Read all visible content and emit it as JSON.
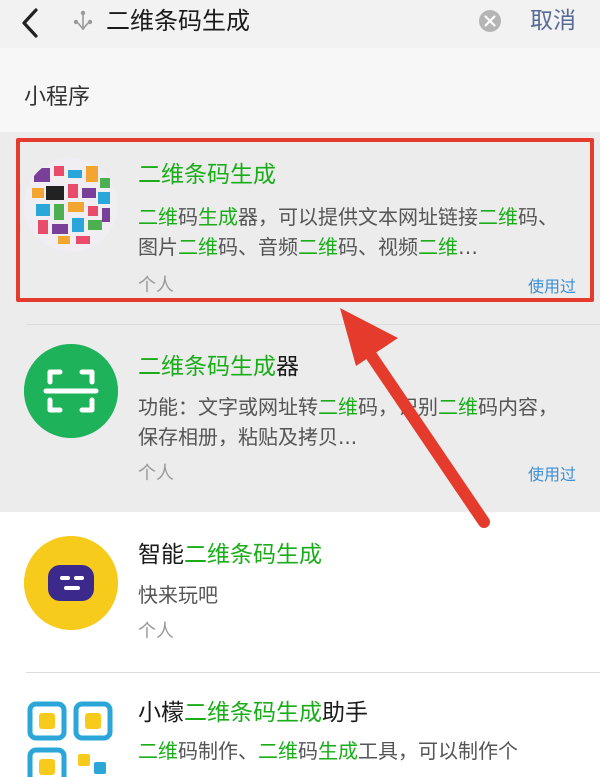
{
  "header": {
    "back_label": "<",
    "search_query": "二维条码生成",
    "cancel_label": "取消"
  },
  "section": {
    "label": "小程序"
  },
  "results": [
    {
      "title_parts": [
        {
          "text": "二维条码生成",
          "hl": true
        }
      ],
      "desc_parts": [
        {
          "text": "二维",
          "hl": true
        },
        {
          "text": "码",
          "hl": false
        },
        {
          "text": "生成",
          "hl": true
        },
        {
          "text": "器，可以提供文本网址链接",
          "hl": false
        },
        {
          "text": "二维",
          "hl": true
        },
        {
          "text": "码、图片",
          "hl": false
        },
        {
          "text": "二维",
          "hl": true
        },
        {
          "text": "码、音频",
          "hl": false
        },
        {
          "text": "二维",
          "hl": true
        },
        {
          "text": "码、视频",
          "hl": false
        },
        {
          "text": "二维",
          "hl": true
        },
        {
          "text": "…",
          "hl": false
        }
      ],
      "meta": "个人",
      "used_label": "使用过",
      "avatar_icon": "qr-collage-icon"
    },
    {
      "title_parts": [
        {
          "text": "二维条码生成",
          "hl": true
        },
        {
          "text": "器",
          "hl": false
        }
      ],
      "desc_parts": [
        {
          "text": "功能：文字或网址转",
          "hl": false
        },
        {
          "text": "二维",
          "hl": true
        },
        {
          "text": "码，识别",
          "hl": false
        },
        {
          "text": "二维",
          "hl": true
        },
        {
          "text": "码内容，保存相册，粘贴及拷贝...",
          "hl": false
        }
      ],
      "meta": "个人",
      "used_label": "使用过",
      "avatar_icon": "scan-frame-icon"
    },
    {
      "title_parts": [
        {
          "text": "智能",
          "hl": false
        },
        {
          "text": "二维条码生成",
          "hl": true
        }
      ],
      "desc_parts": [
        {
          "text": "快来玩吧",
          "hl": false
        }
      ],
      "meta": "个人",
      "used_label": "",
      "avatar_icon": "chat-face-icon"
    },
    {
      "title_parts": [
        {
          "text": "小檬",
          "hl": false
        },
        {
          "text": "二维条码生成",
          "hl": true
        },
        {
          "text": "助手",
          "hl": false
        }
      ],
      "desc_parts": [
        {
          "text": "二维",
          "hl": true
        },
        {
          "text": "码制作、",
          "hl": false
        },
        {
          "text": "二维",
          "hl": true
        },
        {
          "text": "码",
          "hl": false
        },
        {
          "text": "生成",
          "hl": true
        },
        {
          "text": "工具，可以制作个",
          "hl": false
        }
      ],
      "meta": "",
      "used_label": "",
      "avatar_icon": "qr-blocks-icon"
    }
  ],
  "colors": {
    "highlight_green": "#1aad19",
    "annotation_red": "#e53b2c",
    "link_blue": "#3b8fd6",
    "cancel_blue": "#576b95"
  }
}
